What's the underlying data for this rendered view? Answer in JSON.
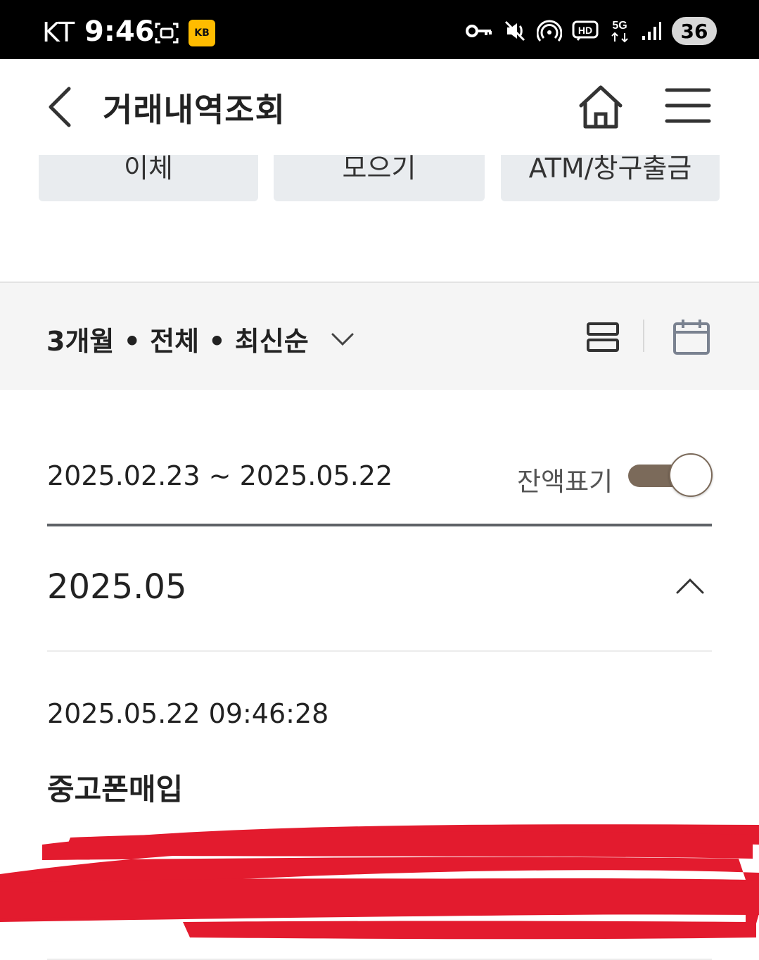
{
  "status_bar": {
    "carrier": "KT",
    "time": "9:46",
    "battery_level": "36",
    "network": "5G",
    "hd_label": "HD",
    "kb_badge_text": "KB"
  },
  "header": {
    "title": "거래내역조회"
  },
  "quick_menu": [
    {
      "label": "이체"
    },
    {
      "label": "모으기"
    },
    {
      "label": "ATM/창구출금"
    }
  ],
  "filter": {
    "summary": "3개월 • 전체 • 최신순"
  },
  "period": {
    "range": "2025.02.23 ~ 2025.05.22",
    "balance_toggle_label": "잔액표기",
    "balance_toggle_on": true
  },
  "month_section": {
    "month": "2025.05",
    "expanded": true
  },
  "transactions": [
    {
      "datetime": "2025.05.22 09:46:28",
      "description": "중고폰매입"
    }
  ],
  "colors": {
    "toggle_accent": "#7b6a5a",
    "redaction": "#e31b2e",
    "filter_bg": "#f5f5f5",
    "quick_btn_bg": "#e9ecef"
  }
}
